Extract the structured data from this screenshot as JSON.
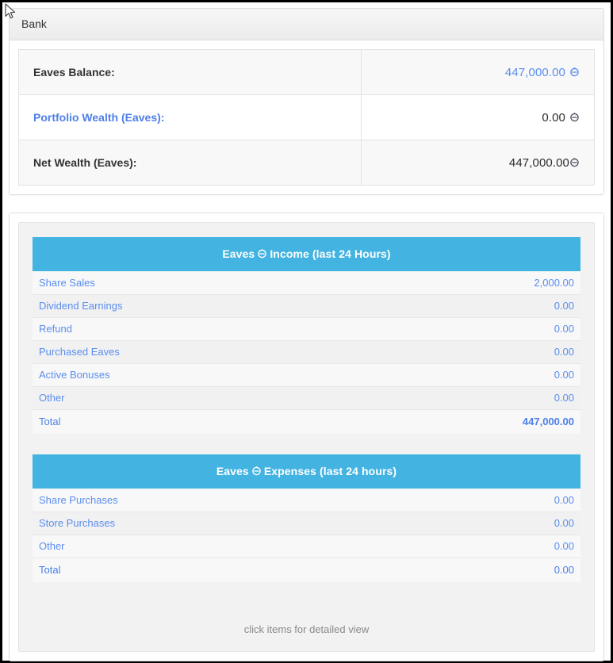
{
  "window": {
    "title": "Bank"
  },
  "icons": {
    "currency": "eaves-coin-icon",
    "cursor": "mouse-pointer-icon"
  },
  "colors": {
    "header_blue": "#43b3e2",
    "link_blue": "#5b8ef0",
    "accent_value": "#5b8ef0",
    "panel_border": "#dddddd",
    "row_alt": "#f1f1f1",
    "note_gray": "#8a8a8a"
  },
  "balance": {
    "rows": [
      {
        "label": "Eaves Balance:",
        "value": "447,000.00",
        "label_is_link": false,
        "value_accent": true
      },
      {
        "label": "Portfolio Wealth (Eaves):",
        "value": "0.00",
        "label_is_link": true,
        "value_accent": false
      },
      {
        "label": "Net Wealth (Eaves):",
        "value": "447,000.00",
        "label_is_link": false,
        "value_accent": false
      }
    ]
  },
  "income": {
    "header_prefix": "Eaves",
    "header_suffix": "Income (last 24 Hours)",
    "rows": [
      {
        "label": "Share Sales",
        "value": "2,000.00"
      },
      {
        "label": "Dividend Earnings",
        "value": "0.00"
      },
      {
        "label": "Refund",
        "value": "0.00"
      },
      {
        "label": "Purchased Eaves",
        "value": "0.00"
      },
      {
        "label": "Active Bonuses",
        "value": "0.00"
      },
      {
        "label": "Other",
        "value": "0.00"
      }
    ],
    "total": {
      "label": "Total",
      "value": "447,000.00"
    }
  },
  "expenses": {
    "header_prefix": "Eaves",
    "header_suffix": "Expenses (last 24 hours)",
    "rows": [
      {
        "label": "Share Purchases",
        "value": "0.00"
      },
      {
        "label": "Store Purchases",
        "value": "0.00"
      },
      {
        "label": "Other",
        "value": "0.00"
      }
    ],
    "total": {
      "label": "Total",
      "value": "0.00"
    }
  },
  "footer": {
    "note": "click items for detailed view"
  }
}
